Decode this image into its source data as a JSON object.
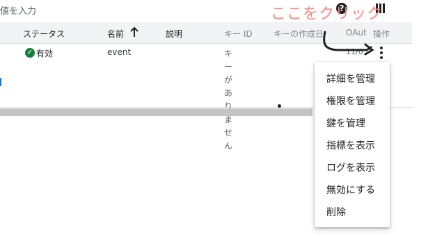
{
  "filter": {
    "text": "値を入力"
  },
  "table": {
    "headers": {
      "status": "ステータス",
      "name": "名前",
      "description": "説明",
      "key_id": "キー ID",
      "key_created": "キーの作成日",
      "oauth": "OAut",
      "actions": "操作"
    },
    "row": {
      "status": "有効",
      "name": "event",
      "key_id": "キーがありません",
      "date": "11/0"
    }
  },
  "annotation": "ここをクリック",
  "menu": {
    "items": [
      "詳細を管理",
      "権限を管理",
      "鍵を管理",
      "指標を表示",
      "ログを表示",
      "無効にする",
      "削除"
    ]
  },
  "colors": {
    "status_green": "#188038",
    "annotation": "#f28b82",
    "header_bg": "#f1f3f4"
  }
}
